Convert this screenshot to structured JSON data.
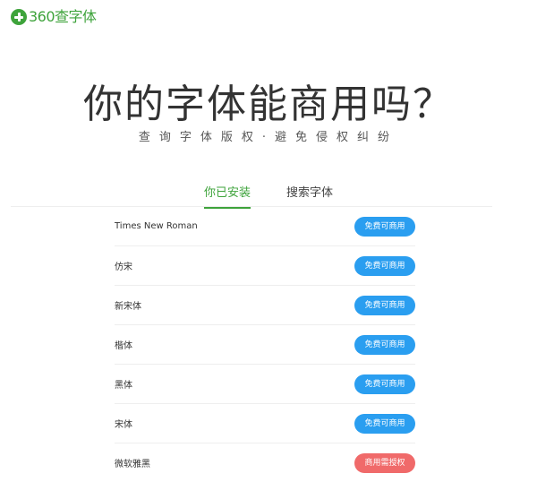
{
  "brand": {
    "name": "360查字体",
    "color": "#3ea33b",
    "icon": "plus-circle-icon"
  },
  "hero": {
    "title": "你的字体能商用吗？",
    "subtitle": "查询字体版权·避免侵权纠纷"
  },
  "tabs": [
    {
      "label": "你已安装",
      "active": true
    },
    {
      "label": "搜索字体",
      "active": false
    }
  ],
  "fonts": [
    {
      "name": "Times New Roman",
      "status": "免费可商用",
      "type": "free"
    },
    {
      "name": "仿宋",
      "status": "免费可商用",
      "type": "free"
    },
    {
      "name": "新宋体",
      "status": "免费可商用",
      "type": "free"
    },
    {
      "name": "楷体",
      "status": "免费可商用",
      "type": "free"
    },
    {
      "name": "黑体",
      "status": "免费可商用",
      "type": "free"
    },
    {
      "name": "宋体",
      "status": "免费可商用",
      "type": "free"
    },
    {
      "name": "微软雅黑",
      "status": "商用需授权",
      "type": "paid"
    }
  ],
  "colors": {
    "free_badge": "#2a9ef0",
    "paid_badge": "#f06a6a"
  }
}
